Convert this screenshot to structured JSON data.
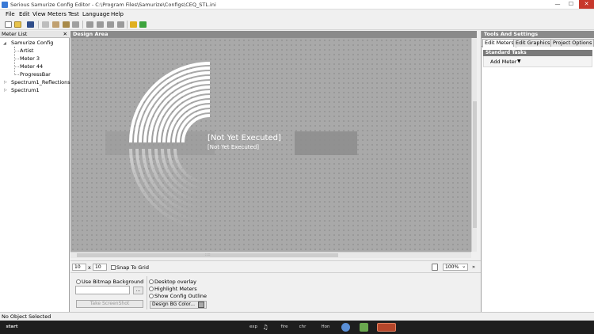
{
  "window": {
    "title": "Serious Samurize Config Editor - C:\\Program Files\\Samurize\\Configs\\CEQ_STL.ini",
    "min_glyph": "—",
    "max_glyph": "☐",
    "close_glyph": "✕"
  },
  "menu": [
    "File",
    "Edit",
    "View",
    "Meters",
    "Test",
    "Language",
    "Help"
  ],
  "toolbar_icons": [
    "new-icon",
    "open-icon",
    "save-icon",
    "cut-icon",
    "copy-icon",
    "paste-icon",
    "delete-icon",
    "move-top-icon",
    "move-up-icon",
    "move-down-icon",
    "move-bottom-icon",
    "back-icon",
    "forward-icon"
  ],
  "meter_list": {
    "header": "Meter List",
    "close_glyph": "✕",
    "tree": [
      {
        "label": "Samurize Config",
        "level": 0,
        "expanded": true
      },
      {
        "label": "Artist",
        "level": 1
      },
      {
        "label": "Meter 3",
        "level": 1
      },
      {
        "label": "Meter 44",
        "level": 1
      },
      {
        "label": "ProgressBar",
        "level": 1
      },
      {
        "label": "Spectrum1_Reflections",
        "level": 0,
        "expanded": false
      },
      {
        "label": "Spectrum1",
        "level": 0,
        "expanded": false
      }
    ]
  },
  "design_area": {
    "header": "Design Area",
    "meter_text_large": "[Not Yet Executed]",
    "meter_text_small": "[Not Yet Executed]",
    "scroll_grip": "::::"
  },
  "grid": {
    "grid_x": "10",
    "x_sep": "x",
    "grid_y": "10",
    "snap_label": "Snap To Grid",
    "zoom": "100%",
    "zoom_arrow": "⌄",
    "more_glyph": "»"
  },
  "bottom": {
    "use_bitmap_bg": "Use Bitmap Background",
    "browse_label": "...",
    "screenshot_button": "Take ScreenShot",
    "desktop_overlay": "Desktop overlay",
    "highlight_meters": "Highlight Meters",
    "show_config_outline": "Show Config Outline",
    "design_bg_color": "Design BG Color..."
  },
  "tools": {
    "header": "Tools And Settings",
    "tabs": [
      "Edit Meters",
      "Edit Graphics",
      "Project Options"
    ],
    "active_tab": 0,
    "standard_tasks": "Standard Tasks",
    "add_meter": "Add Meter",
    "add_meter_arrow": "▼"
  },
  "status": {
    "text": "No Object Selected"
  },
  "taskbar": {
    "start": "start",
    "items": [
      "exp",
      "♫",
      "fire",
      "chr",
      "Hon"
    ]
  },
  "colors": {
    "accent": "#3a7ad6",
    "close": "#c7382c",
    "panel_header": "#8a8a8a"
  }
}
